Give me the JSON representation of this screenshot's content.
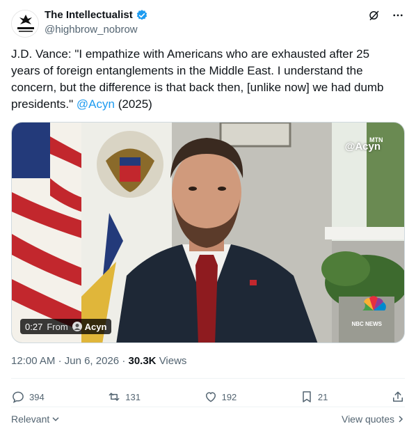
{
  "author": {
    "display_name": "The Intellectualist",
    "handle": "@highbrow_nobrow",
    "verified": true,
    "avatar_icon": "intellectualist-logo"
  },
  "header_icons": [
    "grok-icon",
    "more-icon"
  ],
  "tweet": {
    "text_before": "J.D. Vance: \"I empathize with Americans who are exhausted after 25 years of foreign entanglements in the Middle East. I understand the concern, but the difference is that back then, [unlike now] we had dumb presidents.\" ",
    "mention": "@Acyn",
    "text_after": "  (2025)"
  },
  "media": {
    "watermark": "@Acyn",
    "network_tag": "MTN",
    "network_logo_label": "NBC NEWS",
    "duration": "0:27",
    "from_label": "From",
    "source": "Acyn"
  },
  "meta": {
    "time": "12:00 AM",
    "date": "Jun 6, 2026",
    "views_count": "30.3K",
    "views_label": "Views"
  },
  "actions": {
    "replies": "394",
    "reposts": "131",
    "likes": "192",
    "bookmarks": "21"
  },
  "footer": {
    "relevance_label": "Relevant",
    "quotes_label": "View quotes"
  },
  "colors": {
    "accent": "#1d9bf0",
    "secondary_text": "#536471",
    "primary_text": "#0f1419"
  }
}
